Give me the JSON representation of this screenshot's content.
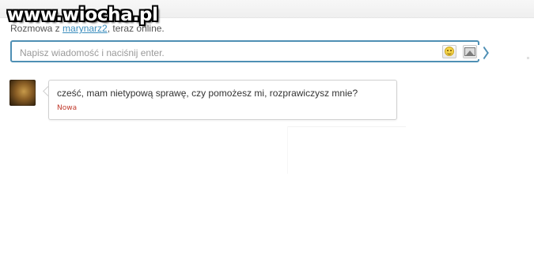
{
  "watermark": {
    "text": "www.wiocha.pl"
  },
  "status": {
    "prefix": "Rozmowa z ",
    "username": "marynarz2",
    "suffix": ", teraz online."
  },
  "composer": {
    "placeholder": "Napisz wiadomość i naciśnij enter.",
    "emoji_button_icon": "smiley-icon",
    "image_button_icon": "image-icon"
  },
  "messages": [
    {
      "text": "cześć, mam nietypową sprawę, czy pomożesz mi, rozprawiczysz mnie?",
      "badge": "Nowa"
    }
  ],
  "colors": {
    "input_border": "#4e8fb4",
    "link": "#3b8dbd",
    "badge": "#c0392b"
  }
}
